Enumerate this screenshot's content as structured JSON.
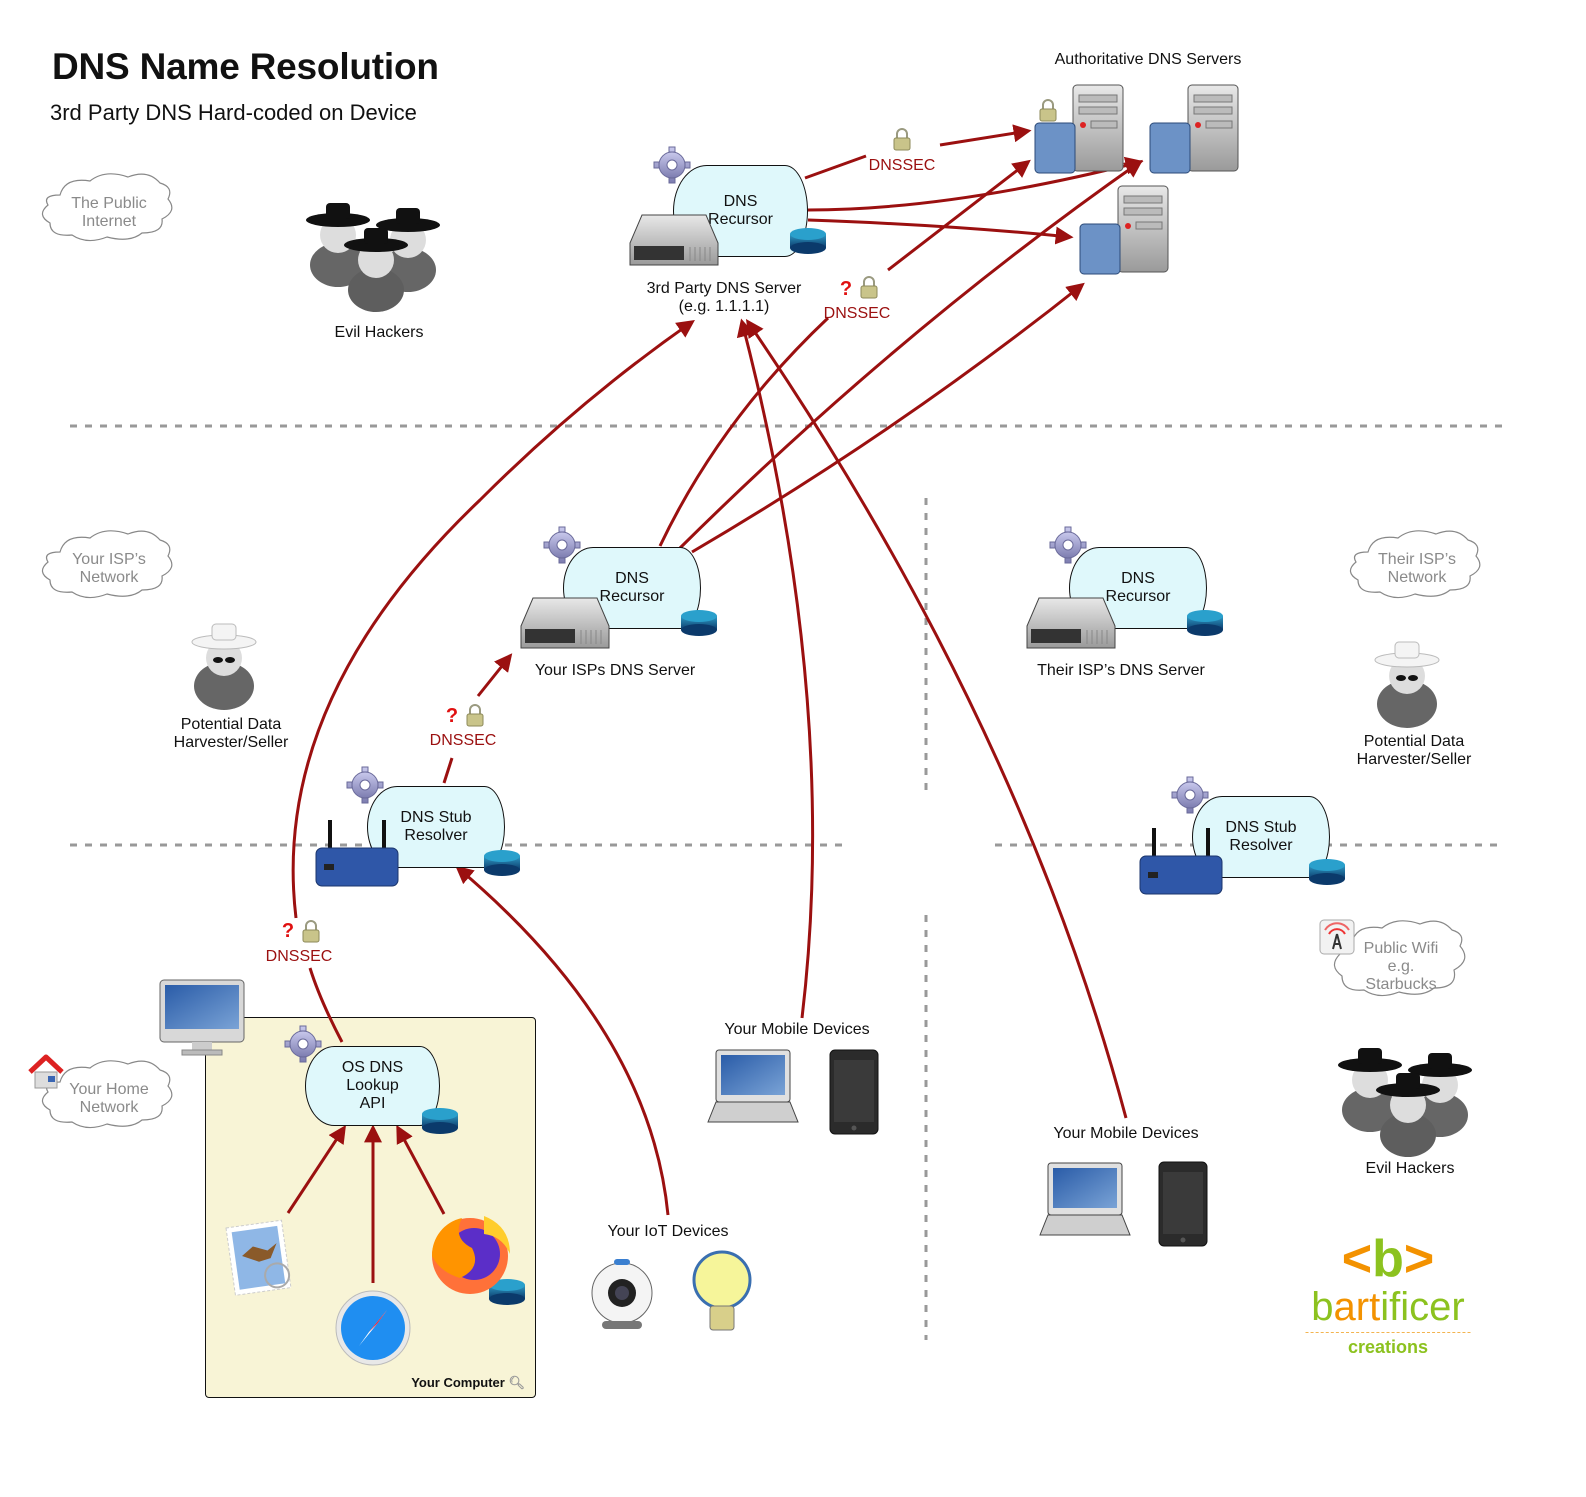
{
  "header": {
    "title": "DNS Name Resolution",
    "subtitle": "3rd Party DNS Hard-coded on Device"
  },
  "zones": {
    "public_internet": "The Public\nInternet",
    "your_isp": "Your ISP’s\nNetwork",
    "their_isp": "Their ISP’s\nNetwork",
    "home": "Your Home\nNetwork",
    "public_wifi": "Public Wifi\ne.g.\nStarbucks"
  },
  "nodes": {
    "authoritative": "Authoritative DNS Servers",
    "third_party_recursor": "DNS\nRecursor",
    "third_party_label": "3rd Party DNS Server\n(e.g. 1.1.1.1)",
    "your_isp_recursor": "DNS\nRecursor",
    "your_isp_label": "Your ISPs DNS Server",
    "their_isp_recursor": "DNS\nRecursor",
    "their_isp_label": "Their ISP’s DNS Server",
    "home_stub": "DNS Stub\nResolver",
    "wifi_stub": "DNS Stub\nResolver",
    "os_api": "OS DNS\nLookup\nAPI",
    "computer_label": "Your Computer",
    "mobile_home": "Your Mobile Devices",
    "mobile_wifi": "Your Mobile Devices",
    "iot": "Your IoT Devices"
  },
  "actors": {
    "evil_hackers_top": "Evil Hackers",
    "evil_hackers_bottom": "Evil Hackers",
    "harvester_left": "Potential Data\nHarvester/Seller",
    "harvester_right": "Potential Data\nHarvester/Seller"
  },
  "annotations": {
    "dnssec_top": "DNSSEC",
    "dnssec_mid": "DNSSEC",
    "dnssec_stub": "DNSSEC",
    "dnssec_os": "DNSSEC",
    "question": "?"
  },
  "logo": {
    "mark_left": "<",
    "mark_b": "b",
    "mark_right": ">",
    "word_a": "b",
    "word_b": "art",
    "word_c": "ificer",
    "tagline": "creations"
  },
  "colors": {
    "arrow": "#9b1010",
    "process_fill": "#dff8fb",
    "computer_fill": "#f8f4d6",
    "zone_text": "#8a8a8a",
    "logo_green": "#8cc21f",
    "logo_orange": "#f39200"
  }
}
